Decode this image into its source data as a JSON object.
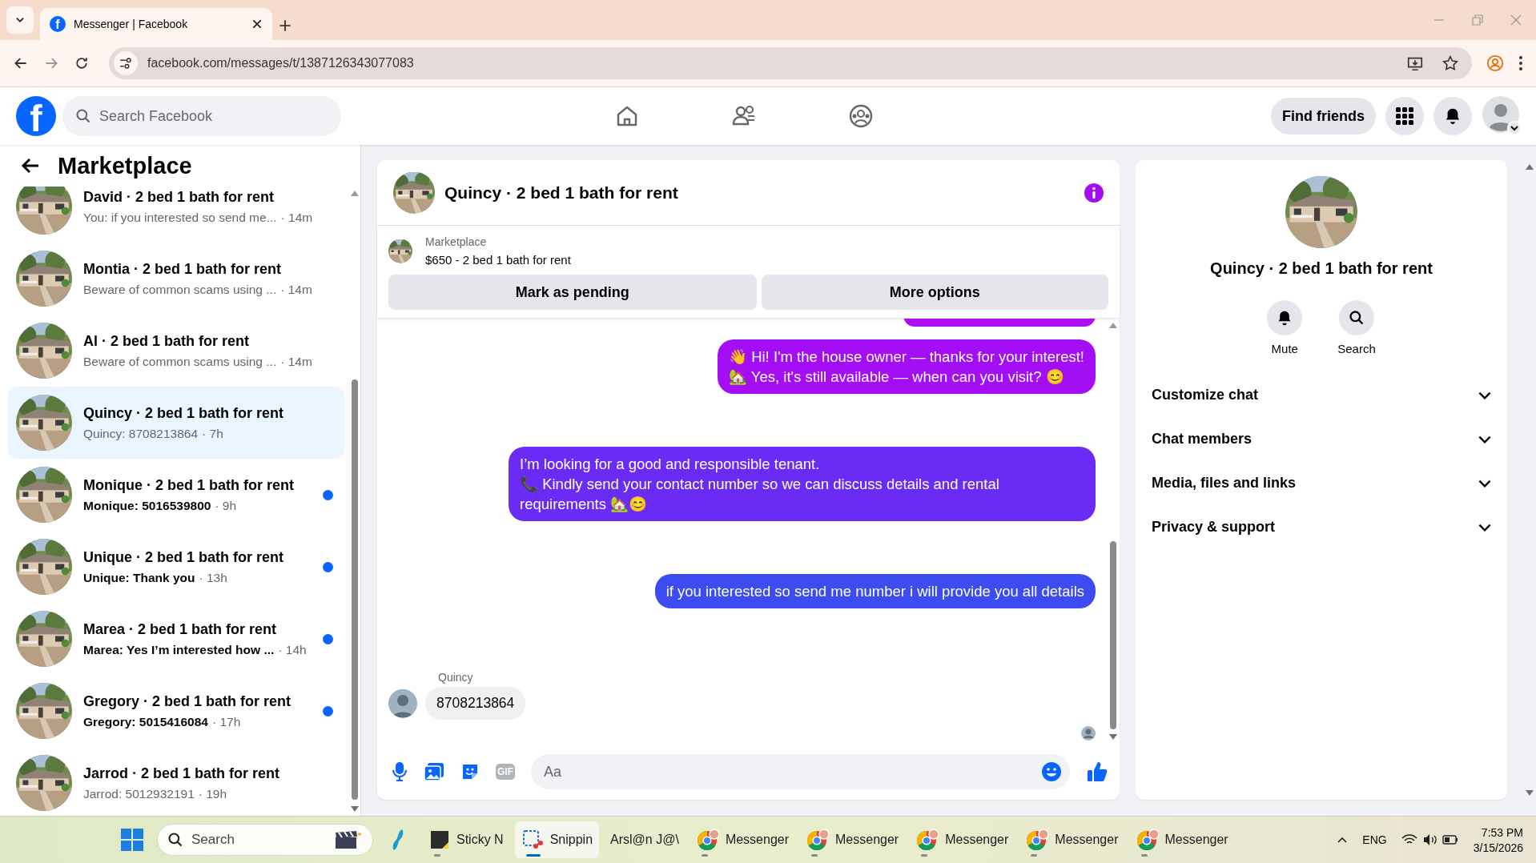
{
  "browser": {
    "tab_favicon": "f",
    "tab_title": "Messenger | Facebook",
    "url": "facebook.com/messages/t/1387126343077083"
  },
  "header": {
    "logo": "f",
    "search_placeholder": "Search Facebook",
    "find_friends": "Find friends"
  },
  "sidebar": {
    "title": "Marketplace",
    "conversations": [
      {
        "name": "David · 2 bed 1 bath for rent",
        "preview": "You: if you interested so send me...",
        "time": "· 14m",
        "unread": false,
        "selected": false
      },
      {
        "name": "Montia · 2 bed 1 bath for rent",
        "preview": "Beware of common scams using ...",
        "time": "· 14m",
        "unread": false,
        "selected": false
      },
      {
        "name": "Al · 2 bed 1 bath for rent",
        "preview": "Beware of common scams using ...",
        "time": "· 14m",
        "unread": false,
        "selected": false
      },
      {
        "name": "Quincy · 2 bed 1 bath for rent",
        "preview": "Quincy: 8708213864",
        "time": "· 7h",
        "unread": false,
        "selected": true
      },
      {
        "name": "Monique · 2 bed 1 bath for rent",
        "preview": "Monique: 5016539800",
        "time": "· 9h",
        "unread": true,
        "selected": false
      },
      {
        "name": "Unique · 2 bed 1 bath for rent",
        "preview": "Unique: Thank you",
        "time": "· 13h",
        "unread": true,
        "selected": false
      },
      {
        "name": "Marea · 2 bed 1 bath for rent",
        "preview": "Marea: Yes I’m interested how ...",
        "time": "· 14h",
        "unread": true,
        "selected": false
      },
      {
        "name": "Gregory · 2 bed 1 bath for rent",
        "preview": "Gregory: 5015416084",
        "time": "· 17h",
        "unread": true,
        "selected": false
      },
      {
        "name": "Jarrod · 2 bed 1 bath for rent",
        "preview": "Jarrod: 5012932191",
        "time": "· 19h",
        "unread": false,
        "selected": false
      }
    ]
  },
  "chat": {
    "title": "Quincy · 2 bed 1 bath for rent",
    "listing": {
      "label": "Marketplace",
      "summary": "$650 - 2 bed 1 bath for rent"
    },
    "actions": [
      "Mark as pending",
      "More options"
    ],
    "messages": [
      {
        "kind": "outgoing",
        "text": "👋 Hi! I'm the house owner — thanks for your interest!\n🏡 Yes, it's still available — when can you visit? 😊"
      },
      {
        "kind": "outgoing",
        "text": "I’m looking for a good and responsible tenant.\n📞 Kindly send your contact number so we can discuss details and rental requirements 🏡😊"
      },
      {
        "kind": "outgoing",
        "text": "if you interested so send me number i will provide you all details"
      },
      {
        "kind": "incoming",
        "sender": "Quincy",
        "text": "8708213864"
      }
    ],
    "gif_label": "GIF",
    "composer_placeholder": "Aa"
  },
  "details": {
    "title": "Quincy · 2 bed 1 bath for rent",
    "actions": [
      "Mute",
      "Search"
    ],
    "sections": [
      {
        "title": "Customize chat",
        "expanded": false
      },
      {
        "title": "Chat members",
        "expanded": false
      },
      {
        "title": "Media, files and links",
        "expanded": false
      },
      {
        "title": "Privacy & support",
        "expanded": false
      }
    ]
  },
  "taskbar": {
    "search_placeholder": "Search",
    "apps": [
      {
        "kind": "sticky",
        "label": "Sticky N",
        "selected": false
      },
      {
        "kind": "snip",
        "label": "Snippin",
        "selected": true
      },
      {
        "kind": "plain",
        "label": "Arsl@n J@\\",
        "selected": false
      },
      {
        "kind": "chrome",
        "label": "Messenger",
        "selected": false
      },
      {
        "kind": "chrome",
        "label": "Messenger",
        "selected": false
      },
      {
        "kind": "chrome",
        "label": "Messenger",
        "selected": false
      },
      {
        "kind": "chrome",
        "label": "Messenger",
        "selected": false
      },
      {
        "kind": "chrome",
        "label": "Messenger",
        "selected": false
      }
    ],
    "language": "ENG",
    "time": "7:53 PM",
    "date": "3/15/2026"
  }
}
